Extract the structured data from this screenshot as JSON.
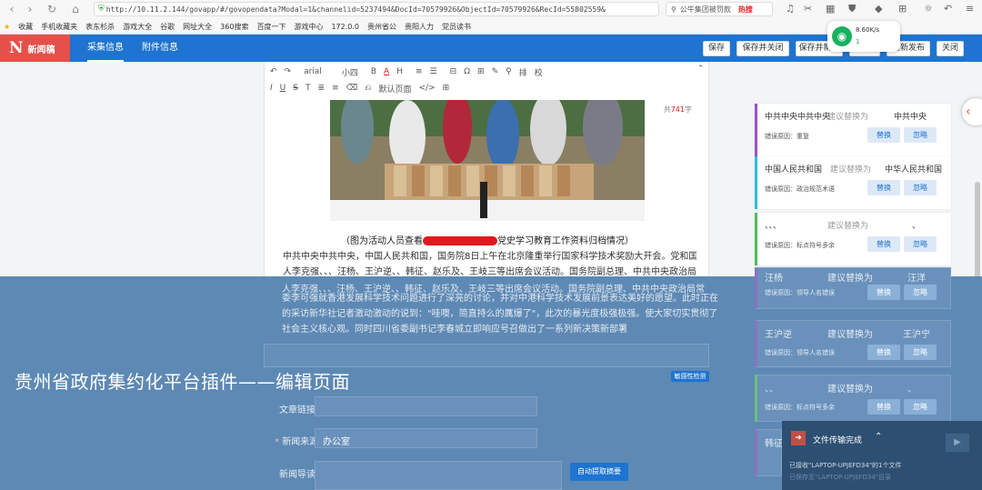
{
  "browser": {
    "url": "http://10.11.2.144/govapp/#/govopendata?Modal=1&channelid=5237494&DocId=70579926&ObjectId=70579926&RecId=55802559&",
    "search_text": "公牛集团被罚款",
    "search_hot": "热搜",
    "bookmarks": [
      "收藏",
      "手机收藏夹",
      "表东杉杀",
      "游戏大全",
      "谷歌",
      "网址大全",
      "360搜索",
      "百度一下",
      "游戏中心",
      "172.0.0",
      "贵州省公",
      "贵阳人力",
      "党员读书"
    ]
  },
  "app": {
    "logo_letter": "N",
    "logo_text": "新闻稿",
    "tabs": [
      "采集信息",
      "附件信息"
    ],
    "actions": [
      "保存",
      "保存并关闭",
      "保存并新建",
      "预览",
      "重新发布",
      "关闭"
    ]
  },
  "wifi_widget": {
    "speed": "8.60K/s",
    "count": "1"
  },
  "editor": {
    "toolbar_row1": [
      "arial",
      "小四",
      "B",
      "A",
      "H",
      "≡",
      "☰",
      "⊟",
      "Ω",
      "⊞",
      "✎",
      "⚲",
      "排",
      "校"
    ],
    "toolbar_row2": [
      "I",
      "U",
      "S",
      "T",
      "≣",
      "≡",
      "⌫",
      "⎌",
      "默认页面",
      "</>",
      "⊞"
    ],
    "word_count_prefix": "共",
    "word_count": "741",
    "word_count_suffix": "字",
    "caption_left": "（图为活动人员查看",
    "caption_right": "党史学习教育工作资料归档情况）",
    "lines": [
      "中共中央中共中央，中国人民共和国，国务院8日上午在北京隆重举行国家科学技术奖励大开会。党和国家领导",
      "人李克强、、、汪杨、王沪逆、、韩征、赵乐及、王岐三等出席会议活动。国务院副总理、中共中央政治局常",
      "委李可强就香港发展科学技术问题进行了深亮的讨论，并对中港科学技术发展前景表达美好的愿望。此时正在",
      "的采访新华社记者激动激动的说到：\"哇噢，简直持么的厲爆了\"，此次的暴光度极强极强。使大家切实贯彻了",
      "社会主义核心观。同时四川省委副书记李春城立即响应号召做出了一系列新决策新部署"
    ]
  },
  "suggestions": [
    {
      "original": "中共中央中共中央",
      "hint": "建议替换为",
      "replacement": "中共中央",
      "reason": "错误原因：重复",
      "replace_label": "替换",
      "ignore_label": "忽略",
      "color": "#9a52c9"
    },
    {
      "original": "中国人民共和国",
      "hint": "建议替换为",
      "replacement": "中华人民共和国",
      "reason": "错误原因：政治规范术语",
      "replace_label": "替换",
      "ignore_label": "忽略",
      "color": "#2fbdd6"
    },
    {
      "original": "、、、",
      "hint": "建议替换为",
      "replacement": "、",
      "reason": "错误原因：标点符号多余",
      "replace_label": "替换",
      "ignore_label": "忽略",
      "color": "#4bbf5a"
    },
    {
      "original": "汪杨",
      "hint": "建议替换为",
      "replacement": "汪洋",
      "reason": "错误原因：领导人名错误",
      "replace_label": "替换",
      "ignore_label": "忽略",
      "color": "#9a52c9"
    },
    {
      "original": "王沪逆",
      "hint": "建议替换为",
      "replacement": "王沪宁",
      "reason": "错误原因：领导人名错误",
      "replace_label": "替换",
      "ignore_label": "忽略",
      "color": "#9a52c9"
    },
    {
      "original": "、、",
      "hint": "建议替换为",
      "replacement": "、",
      "reason": "错误原因：标点符号多余",
      "replace_label": "替换",
      "ignore_label": "忽略",
      "color": "#4bbf5a"
    },
    {
      "original": "韩征",
      "hint": "",
      "replacement": "",
      "reason": "",
      "replace_label": "",
      "ignore_label": "",
      "color": "#9a52c9"
    }
  ],
  "form": {
    "link_label": "文章链接",
    "source_label": "新闻来源",
    "source_required": "*",
    "source_value": "办公室",
    "summary_label": "新闻导读",
    "auto_summary_btn": "自动提取摘要",
    "sensitive_check_btn": "敏感性检测"
  },
  "overlay_title": "贵州省政府集约化平台插件——编辑页面",
  "file_transfer": {
    "title": "文件传输完成",
    "line1": "已接收\"LAPTOP-UPJEFD34\"的1个文件",
    "line2": "已保存至\"LAPTOP-UPJEFD34\"目录"
  }
}
